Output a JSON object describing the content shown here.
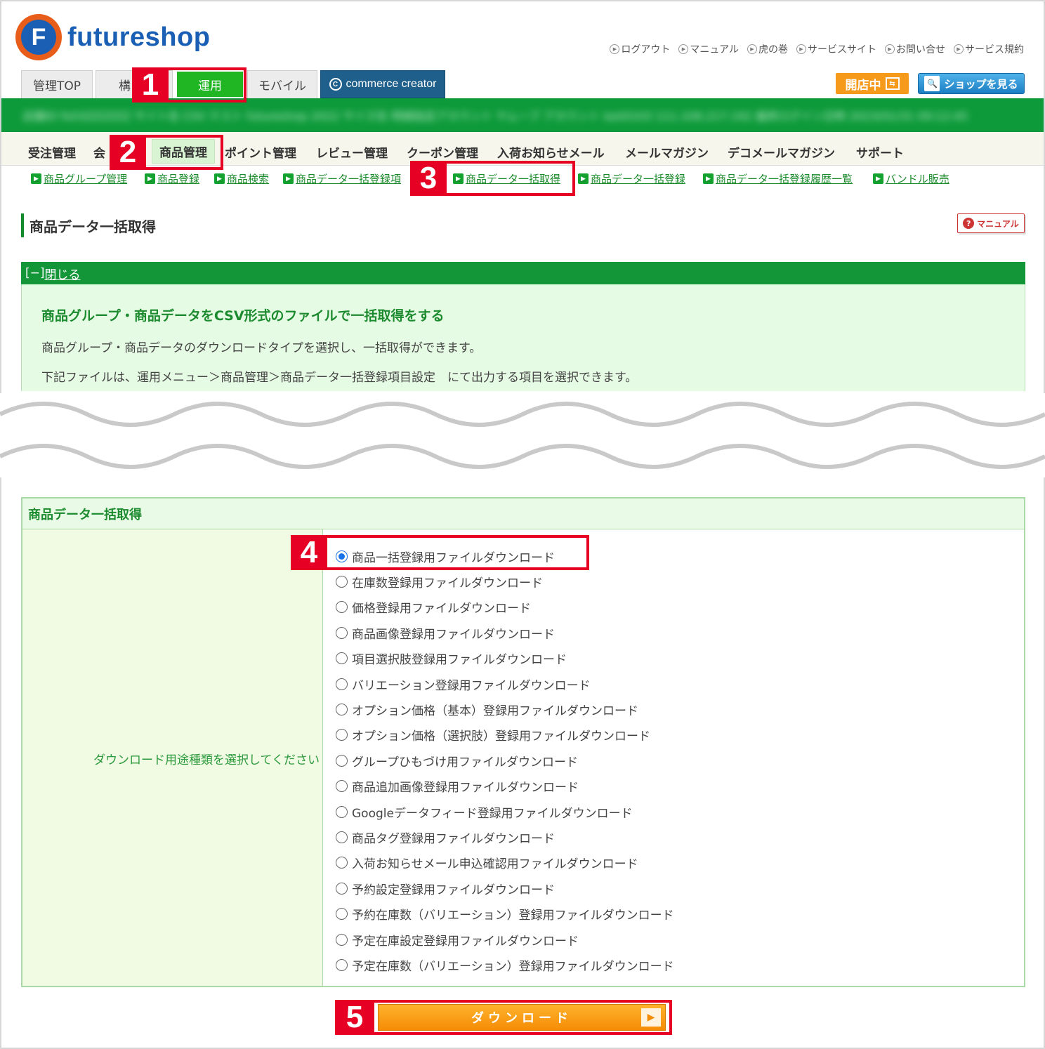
{
  "brand": {
    "mark": "F",
    "name": "futureshop"
  },
  "top_links": [
    {
      "label": "ログアウト"
    },
    {
      "label": "マニュアル"
    },
    {
      "label": "虎の巻"
    },
    {
      "label": "サービスサイト"
    },
    {
      "label": "お問い合せ"
    },
    {
      "label": "サービス規約"
    }
  ],
  "tabs": [
    {
      "label": "管理TOP"
    },
    {
      "label": "構"
    },
    {
      "label": "運用"
    },
    {
      "label": "モバイル"
    },
    {
      "label": "commerce creator"
    }
  ],
  "shop_status": {
    "label": "開店中"
  },
  "view_shop": {
    "label": "ショップを見る"
  },
  "account_bar": {
    "text": "店舗ID  fs03ZZZZZZ  サイト名  CSV テスト  futureshop  2022 サイズ名  明細指定アカウント  ヤムーブ アカウント  last0103  111.108.217.192  最終ログイン日時  2023/01/31 09:12:45"
  },
  "main_menu": [
    {
      "label": "受注管理"
    },
    {
      "label": "会"
    },
    {
      "label": "商品管理"
    },
    {
      "label": "ポイント管理"
    },
    {
      "label": "レビュー管理"
    },
    {
      "label": "クーポン管理"
    },
    {
      "label": "入荷お知らせメール"
    },
    {
      "label": "メールマガジン"
    },
    {
      "label": "デコメールマガジン"
    },
    {
      "label": "サポート"
    }
  ],
  "sub_menu": [
    {
      "label": "商品グループ管理"
    },
    {
      "label": "商品登録"
    },
    {
      "label": "商品検索"
    },
    {
      "label": "商品データ一括登録項"
    },
    {
      "label": "商品データ一括取得"
    },
    {
      "label": "商品データ一括登録"
    },
    {
      "label": "商品データ一括登録履歴一覧"
    },
    {
      "label": "バンドル販売"
    }
  ],
  "page": {
    "title": "商品データ一括取得",
    "manual_label": "マニュアル"
  },
  "info": {
    "toggle_prefix": "[−]",
    "toggle_label": "閉じる",
    "heading": "商品グループ・商品データをCSV形式のファイルで一括取得をする",
    "line1": "商品グループ・商品データのダウンロードタイプを選択し、一括取得ができます。",
    "line2": "下記ファイルは、運用メニュー＞商品管理＞商品データ一括登録項目設定　にて出力する項目を選択できます。"
  },
  "form": {
    "heading": "商品データ一括取得",
    "label": "ダウンロード用途種類を選択してください",
    "selected_index": 0,
    "options": [
      "商品一括登録用ファイルダウンロード",
      "在庫数登録用ファイルダウンロード",
      "価格登録用ファイルダウンロード",
      "商品画像登録用ファイルダウンロード",
      "項目選択肢登録用ファイルダウンロード",
      "バリエーション登録用ファイルダウンロード",
      "オプション価格（基本）登録用ファイルダウンロード",
      "オプション価格（選択肢）登録用ファイルダウンロード",
      "グループひもづけ用ファイルダウンロード",
      "商品追加画像登録用ファイルダウンロード",
      "Googleデータフィード登録用ファイルダウンロード",
      "商品タグ登録用ファイルダウンロード",
      "入荷お知らせメール申込確認用ファイルダウンロード",
      "予約設定登録用ファイルダウンロード",
      "予約在庫数（バリエーション）登録用ファイルダウンロード",
      "予定在庫設定登録用ファイルダウンロード",
      "予定在庫数（バリエーション）登録用ファイルダウンロード"
    ],
    "download_label": "ダウンロード"
  },
  "annotations": {
    "step1": "1",
    "step2": "2",
    "step3": "3",
    "step4": "4",
    "step5": "5",
    "color": "#e60023"
  },
  "colors": {
    "brand_blue": "#1a5fb4",
    "brand_orange": "#e85d1a",
    "green": "#139638",
    "light_green": "#e6fbe4",
    "button_orange": "#f58c05"
  }
}
